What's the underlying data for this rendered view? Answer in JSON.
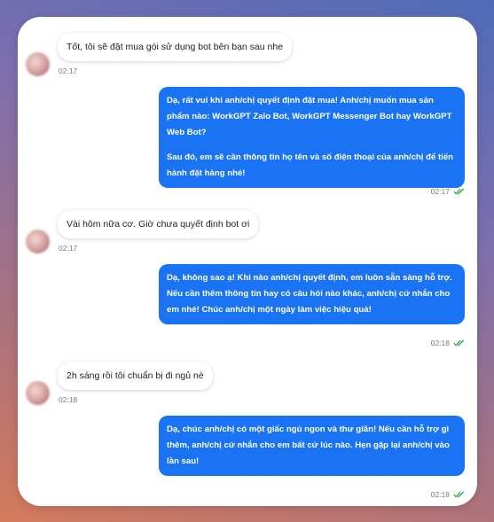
{
  "messages": [
    {
      "from": "user",
      "text": "Tốt, tôi sẽ đặt mua gói sử dụng bot bên bạn sau nhe",
      "time": "02:17"
    },
    {
      "from": "bot",
      "paragraphs": [
        "Dạ, rất vui khi anh/chị quyết định đặt mua! Anh/chị muốn mua sản phẩm nào: WorkGPT Zalo Bot, WorkGPT Messenger Bot hay WorkGPT Web Bot?",
        "Sau đó, em sẽ cần thông tin họ tên và số điện thoại của anh/chị để tiến hành đặt hàng nhé!"
      ],
      "time": "02:17"
    },
    {
      "from": "user",
      "text": "Vài hôm nữa cơ. Giờ chưa quyết định bot ơi",
      "time": "02:17"
    },
    {
      "from": "bot",
      "paragraphs": [
        "Dạ, không sao ạ! Khi nào anh/chị quyết định, em luôn sẵn sàng hỗ trợ. Nếu cần thêm thông tin hay có câu hỏi nào khác, anh/chị cứ nhắn cho em nhé! Chúc anh/chị một ngày làm việc hiệu quả!"
      ],
      "time": "02:18"
    },
    {
      "from": "user",
      "text": "2h sáng rồi tôi chuẩn bị đi ngủ nè",
      "time": "02:18"
    },
    {
      "from": "bot",
      "paragraphs": [
        "Dạ, chúc anh/chị có một giấc ngủ ngon và thư giãn! Nếu cần hỗ trợ gì thêm, anh/chị cứ nhắn cho em bất cứ lúc nào. Hẹn gặp lại anh/chị vào lần sau!"
      ],
      "time": "02:18"
    }
  ],
  "colors": {
    "bot_bubble": "#1a73f2",
    "check": "#2aa84a"
  },
  "icons": {
    "read_receipt": "double-check-icon",
    "avatar": "blurred-user-avatar"
  }
}
